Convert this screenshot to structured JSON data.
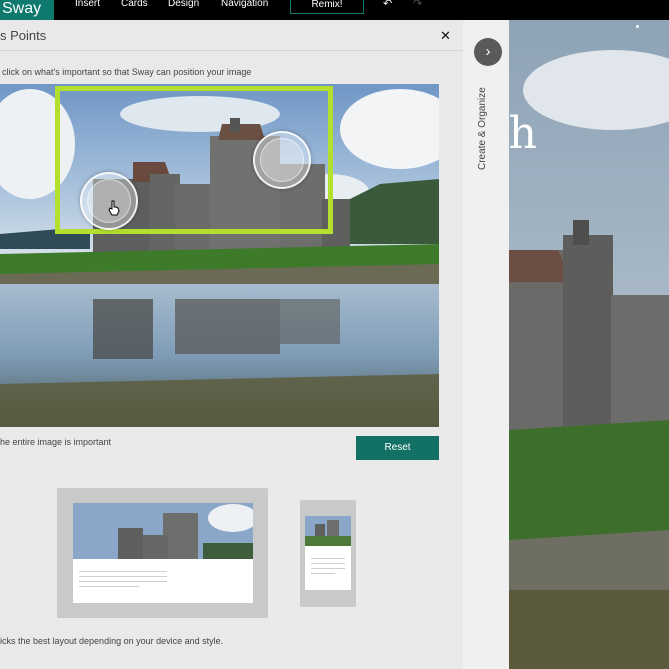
{
  "app": {
    "logo": "Sway"
  },
  "menu": [
    {
      "label": "Insert"
    },
    {
      "label": "Cards"
    },
    {
      "label": "Design"
    },
    {
      "label": "Navigation"
    }
  ],
  "toolbar": {
    "remix_label": "Remix!",
    "undo_icon": "undo-icon",
    "redo_icon": "redo-icon"
  },
  "panel": {
    "title": "s Points",
    "instructions": "click on what's important so that Sway can position your image",
    "entire_image_label": "he entire image is important",
    "reset_label": "Reset",
    "footer_text": "icks the best layout depending on your device and style."
  },
  "side": {
    "create_organize": "Create & Organize"
  },
  "canvas": {
    "title": "rch"
  },
  "colors": {
    "brand": "#0e7a6e",
    "focus": "#b3e02e",
    "reset": "#137064"
  }
}
